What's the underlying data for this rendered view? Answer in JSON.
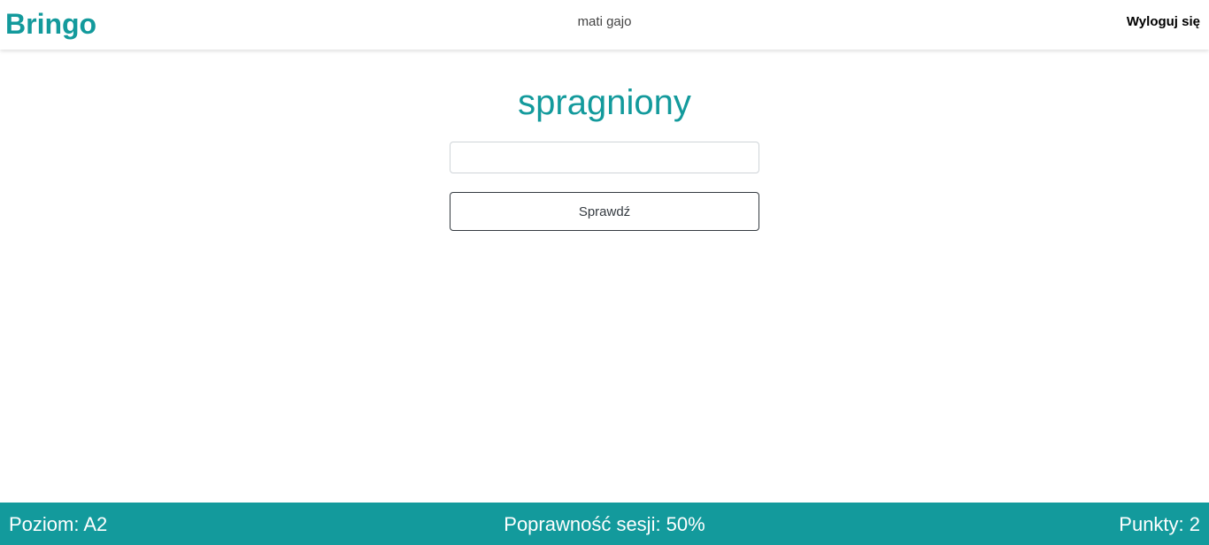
{
  "navbar": {
    "brand": "Bringo",
    "username": "mati gajo",
    "logout_label": "Wyloguj się"
  },
  "quiz": {
    "word": "spragniony",
    "answer_value": "",
    "answer_placeholder": "",
    "check_label": "Sprawdź"
  },
  "footer": {
    "level": "Poziom: A2",
    "session_accuracy": "Poprawność sesji: 50%",
    "points": "Punkty: 2"
  },
  "colors": {
    "accent": "#139a9c",
    "button_border": "#343a40"
  }
}
